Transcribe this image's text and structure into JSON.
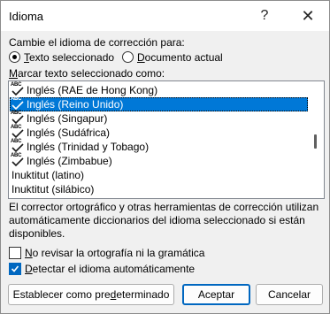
{
  "window": {
    "title": "Idioma",
    "help_label": "?",
    "close_label": "✕"
  },
  "mark_section": {
    "label": "Cambie el idioma de corrección para:",
    "options": [
      {
        "label_underlined": "T",
        "label_rest": "exto seleccionado",
        "checked": true
      },
      {
        "label_underlined": "D",
        "label_rest": "ocumento actual",
        "checked": false
      }
    ]
  },
  "list_label_underlined": "M",
  "list_label_rest": "arcar texto seleccionado como:",
  "languages": [
    {
      "name": "Inglés (RAE de Hong Kong)",
      "spellcheck": true,
      "selected": false
    },
    {
      "name": "Inglés (Reino Unido)",
      "spellcheck": true,
      "selected": true
    },
    {
      "name": "Inglés (Singapur)",
      "spellcheck": true,
      "selected": false
    },
    {
      "name": "Inglés (Sudáfrica)",
      "spellcheck": true,
      "selected": false
    },
    {
      "name": "Inglés (Trinidad y Tobago)",
      "spellcheck": true,
      "selected": false
    },
    {
      "name": "Inglés (Zimbabue)",
      "spellcheck": true,
      "selected": false
    },
    {
      "name": "Inuktitut (latino)",
      "spellcheck": false,
      "selected": false
    },
    {
      "name": "Inuktitut (silábico)",
      "spellcheck": false,
      "selected": false
    }
  ],
  "spell_icon_text": "ABC",
  "info_text": "El corrector ortográfico y otras herramientas de corrección utilizan automáticamente diccionarios del idioma seleccionado si están disponibles.",
  "checkboxes": [
    {
      "label_underlined": "N",
      "label_rest": "o revisar la ortografía ni la gramática",
      "checked": false
    },
    {
      "label_underlined": "D",
      "label_rest": "etectar el idioma automáticamente",
      "checked": true
    }
  ],
  "buttons": {
    "set_default_pre": "Establecer como pre",
    "set_default_u": "d",
    "set_default_post": "eterminado",
    "ok": "Aceptar",
    "cancel": "Cancelar"
  },
  "colors": {
    "selection": "#0078d7",
    "checkbox_checked": "#0067c0",
    "default_button_border": "#0067c0"
  }
}
